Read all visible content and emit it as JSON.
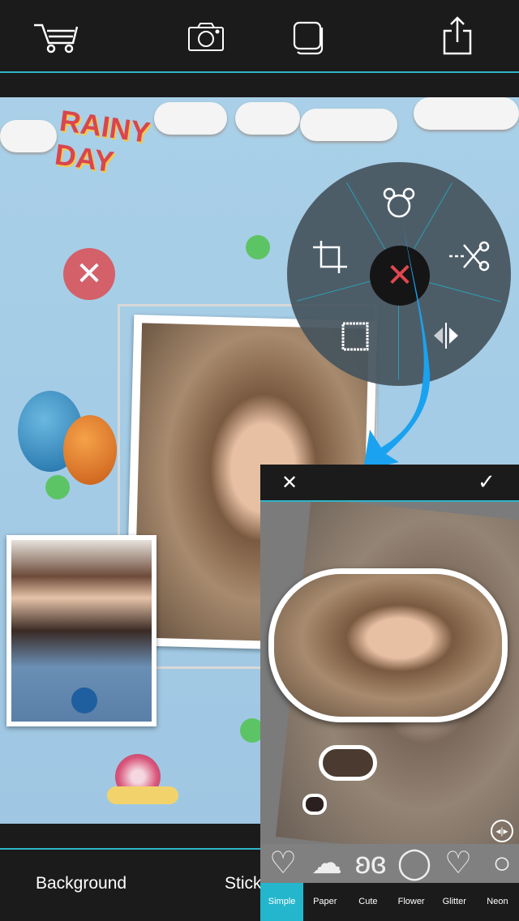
{
  "toolbar": {
    "icons": [
      "cart-icon",
      "camera-icon",
      "layers-icon",
      "share-icon"
    ]
  },
  "canvas": {
    "sticker_text": "RAINY DAY",
    "background_color": "#a9d0e8"
  },
  "radial_menu": {
    "items": [
      "mouse-shape-icon",
      "crop-icon",
      "scissors-icon",
      "frame-icon",
      "flip-icon",
      "close-icon"
    ]
  },
  "bottom_tabs": [
    {
      "label": "Background"
    },
    {
      "label": "Stickers"
    }
  ],
  "shape_panel": {
    "tabs": [
      {
        "label": "Simple",
        "active": true
      },
      {
        "label": "Paper"
      },
      {
        "label": "Cute"
      },
      {
        "label": "Flower"
      },
      {
        "label": "Glitter"
      },
      {
        "label": "Neon"
      }
    ],
    "shapes": [
      "heart",
      "cloud",
      "butterfly",
      "mouse",
      "heart-tilted",
      "bomb"
    ]
  },
  "colors": {
    "accent": "#2fb4c8",
    "active_tab": "#24b6cc",
    "delete": "#e0474e"
  }
}
